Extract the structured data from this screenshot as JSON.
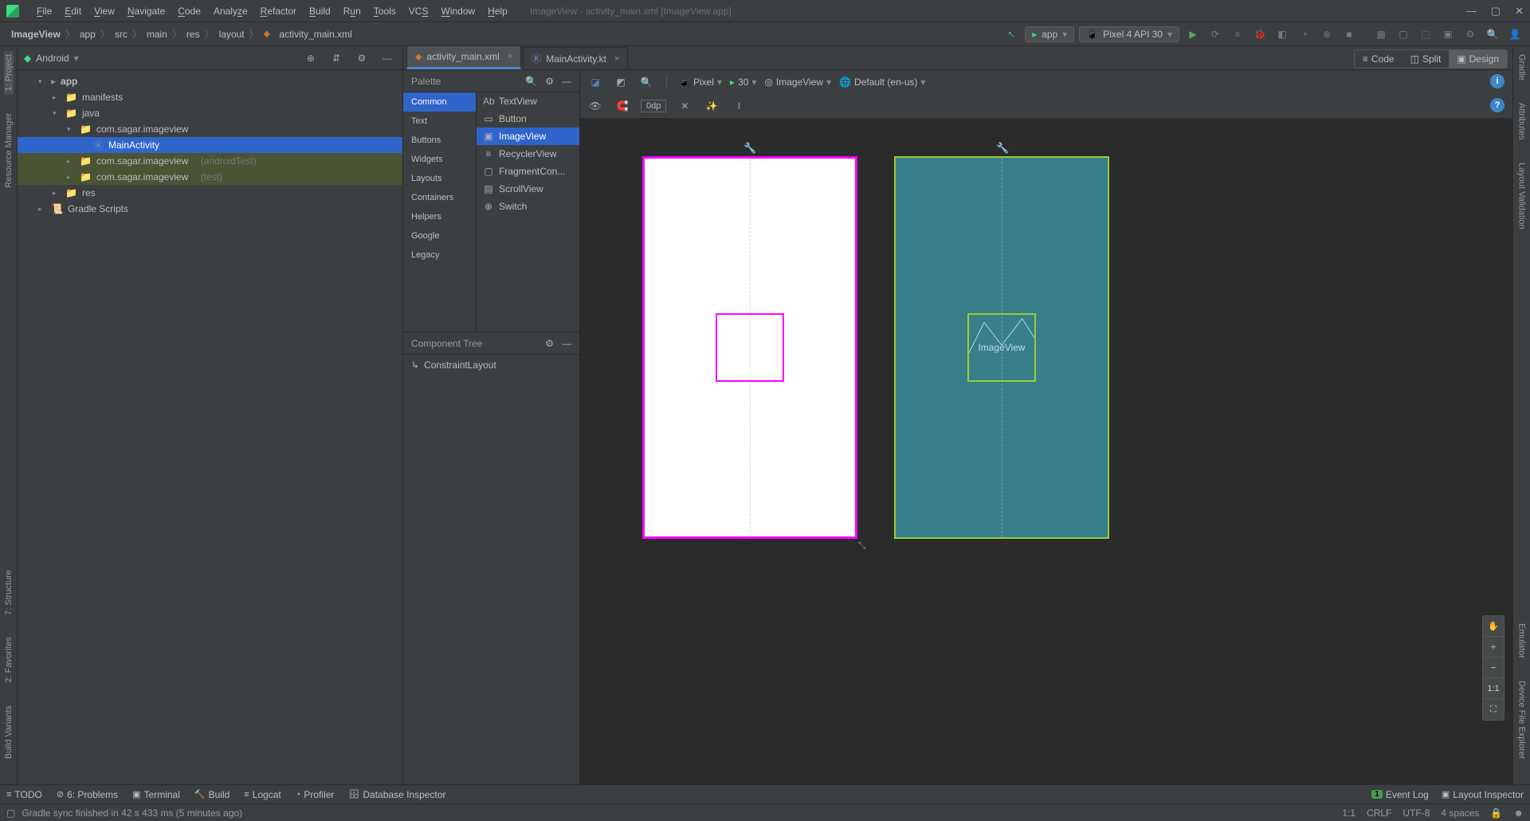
{
  "window": {
    "title_path": "ImageView - activity_main.xml [ImageView.app]"
  },
  "menu": [
    "File",
    "Edit",
    "View",
    "Navigate",
    "Code",
    "Analyze",
    "Refactor",
    "Build",
    "Run",
    "Tools",
    "VCS",
    "Window",
    "Help"
  ],
  "breadcrumbs": [
    "ImageView",
    "app",
    "src",
    "main",
    "res",
    "layout",
    "activity_main.xml"
  ],
  "run_config": {
    "module": "app",
    "device": "Pixel 4 API 30"
  },
  "left_tabs": {
    "project": "1: Project",
    "resmgr": "Resource Manager",
    "structure": "7: Structure",
    "favorites": "2: Favorites",
    "variants": "Build Variants"
  },
  "right_tabs": {
    "gradle": "Gradle",
    "layoutval": "Layout Validation",
    "emulator": "Emulator",
    "devfile": "Device File Explorer"
  },
  "project_panel": {
    "selector": "Android",
    "tree": {
      "app": "app",
      "manifests": "manifests",
      "java": "java",
      "pkg_main": "com.sagar.imageview",
      "main_activity": "MainActivity",
      "pkg_android_test": "com.sagar.imageview",
      "pkg_android_test_suffix": "(androidTest)",
      "pkg_test": "com.sagar.imageview",
      "pkg_test_suffix": "(test)",
      "res": "res",
      "gradle": "Gradle Scripts"
    }
  },
  "editor_tabs": [
    {
      "label": "activity_main.xml",
      "active": true,
      "icon": "xml"
    },
    {
      "label": "MainActivity.kt",
      "active": false,
      "icon": "kt"
    }
  ],
  "view_switch": {
    "code": "Code",
    "split": "Split",
    "design": "Design"
  },
  "palette": {
    "title": "Palette",
    "categories": [
      "Common",
      "Text",
      "Buttons",
      "Widgets",
      "Layouts",
      "Containers",
      "Helpers",
      "Google",
      "Legacy"
    ],
    "active_category": "Common",
    "items": [
      {
        "icon": "Ab",
        "label": "TextView"
      },
      {
        "icon": "▭",
        "label": "Button"
      },
      {
        "icon": "▣",
        "label": "ImageView",
        "active": true
      },
      {
        "icon": "≡",
        "label": "RecyclerView"
      },
      {
        "icon": "▢",
        "label": "FragmentCon..."
      },
      {
        "icon": "▤",
        "label": "ScrollView"
      },
      {
        "icon": "⊕",
        "label": "Switch"
      }
    ]
  },
  "component_tree": {
    "title": "Component Tree",
    "root": "ConstraintLayout"
  },
  "surface_toolbar": {
    "device": "Pixel",
    "api": "30",
    "theme": "ImageView",
    "locale": "Default (en-us)"
  },
  "surface_toolbar2": {
    "margin": "0dp"
  },
  "blueprint_label": "ImageView",
  "zoom_controls": {
    "pan": "✋",
    "plus": "+",
    "minus": "−",
    "oneone": "1:1",
    "fit": "⛶"
  },
  "bottom_tools": {
    "todo": "TODO",
    "problems": "6: Problems",
    "terminal": "Terminal",
    "build": "Build",
    "logcat": "Logcat",
    "profiler": "Profiler",
    "dbinsp": "Database Inspector",
    "eventlog": "Event Log",
    "layoutinsp": "Layout Inspector"
  },
  "status": {
    "msg": "Gradle sync finished in 42 s 433 ms (5 minutes ago)",
    "pos": "1:1",
    "sep": "CRLF",
    "enc": "UTF-8",
    "indent": "4 spaces"
  }
}
